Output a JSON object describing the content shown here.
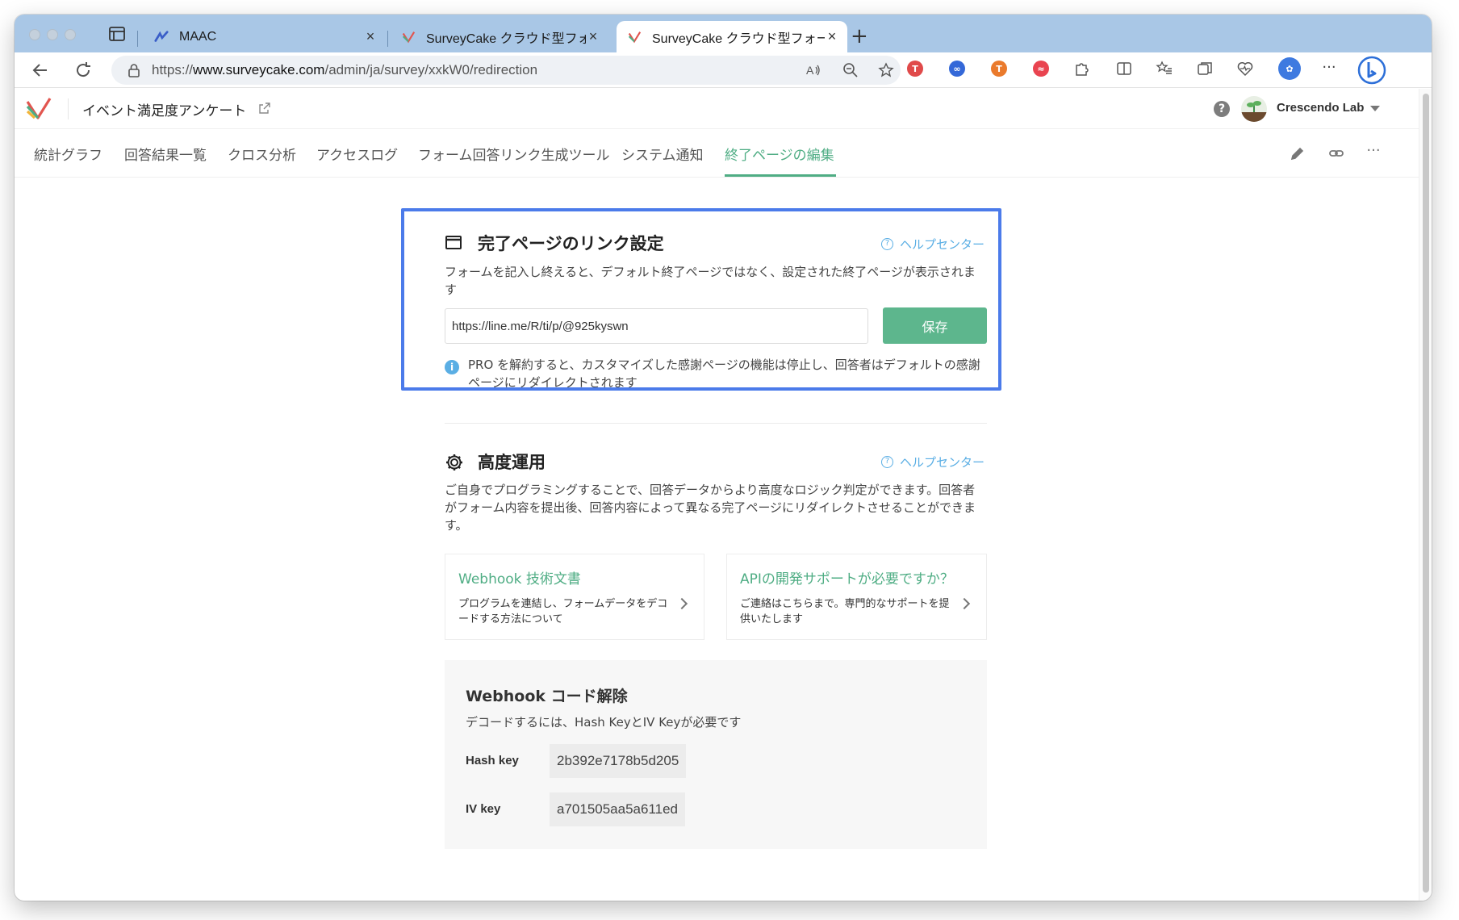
{
  "browser": {
    "tabs": [
      {
        "title": "MAAC",
        "favicon": "maac-favicon"
      },
      {
        "title": "SurveyCake クラウド型フォー",
        "favicon": "surveycake-favicon"
      },
      {
        "title": "SurveyCake クラウド型フォー",
        "favicon": "surveycake-favicon",
        "active": true
      }
    ],
    "close_glyph": "×",
    "new_tab_glyph": "+",
    "url_prefix": "https://",
    "url_domain": "www.surveycake.com",
    "url_path": "/admin/ja/survey/xxkW0/redirection",
    "more_glyph": "···",
    "colors": {
      "tabstrip": "#a9c7e6",
      "omnibox": "#eef1f5"
    }
  },
  "app": {
    "survey_title": "イベント満足度アンケート",
    "help_glyph": "?",
    "account_name": "Crescendo Lab",
    "accent_color": "#4fad84",
    "nav": [
      {
        "label": "統計グラフ"
      },
      {
        "label": "回答結果一覧"
      },
      {
        "label": "クロス分析"
      },
      {
        "label": "アクセスログ"
      },
      {
        "label": "フォーム回答リンク生成ツール"
      },
      {
        "label": "システム通知"
      },
      {
        "label": "終了ページの編集",
        "active": true
      }
    ],
    "more_glyph": "···"
  },
  "completion_link": {
    "title": "完了ページのリンク設定",
    "help_link": "ヘルプセンター",
    "help_glyph": "?",
    "description_line1": "フォームを記入し終えると、デフォルト終了ページではなく、設定された終了ページが表示されま",
    "description_line2": "す",
    "url_value": "https://line.me/R/ti/p/@925kyswn",
    "save_label": "保存",
    "info_glyph": "i",
    "notice_line1": "PRO を解約すると、カスタマイズした感謝ページの機能は停止し、回答者はデフォルトの感謝",
    "notice_line2": "ページにリダイレクトされます",
    "highlight_color": "#4b7bea"
  },
  "advanced": {
    "title": "高度運用",
    "help_link": "ヘルプセンター",
    "help_glyph": "?",
    "description_line1": "ご自身でプログラミングすることで、回答データからより高度なロジック判定ができます。回答者",
    "description_line2": "がフォーム内容を提出後、回答内容によって異なる完了ページにリダイレクトさせることができま",
    "description_line3": "す。",
    "cards": [
      {
        "title": "Webhook 技術文書",
        "desc_line1": "プログラムを連結し、フォームデータをデコ",
        "desc_line2": "ードする方法について"
      },
      {
        "title": "APIの開発サポートが必要ですか？",
        "desc_line1": "ご連絡はこちらまで。専門的なサポートを提",
        "desc_line2": "供いたします"
      }
    ]
  },
  "webhook": {
    "title": "Webhook コード解除",
    "description": "デコードするには、Hash KeyとIV Keyが必要です",
    "hash_label": "Hash key",
    "hash_value": "2b392e7178b5d205",
    "iv_label": "IV key",
    "iv_value": "a701505aa5a611ed"
  }
}
